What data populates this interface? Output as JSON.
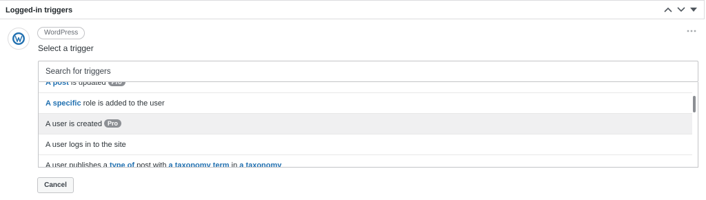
{
  "panel": {
    "title": "Logged-in triggers",
    "collapse_icon": "chevron-up-icon",
    "expand_icon": "chevron-down-icon",
    "toggle_icon": "triangle-down-icon"
  },
  "integration": {
    "avatar_icon": "wordpress-logo-icon",
    "badge": "WordPress",
    "more_icon": "more-dots-icon"
  },
  "trigger_select": {
    "label": "Select a trigger",
    "search_placeholder": "Search for triggers",
    "search_value": "",
    "hovered_index": 2,
    "scroll_position": 0.2,
    "options": [
      {
        "parts": [
          {
            "text": "A post",
            "hl": true
          },
          {
            "text": " is updated"
          }
        ],
        "pro": "Pro"
      },
      {
        "parts": [
          {
            "text": "A specific",
            "hl": true
          },
          {
            "text": " role is added to the user"
          }
        ]
      },
      {
        "parts": [
          {
            "text": "A user is created"
          }
        ],
        "pro": "Pro"
      },
      {
        "parts": [
          {
            "text": "A user logs in to the site"
          }
        ]
      },
      {
        "parts": [
          {
            "text": "A user publishes a "
          },
          {
            "text": "type of",
            "hl": true
          },
          {
            "text": " post with "
          },
          {
            "text": "a taxonomy term",
            "hl": true
          },
          {
            "text": " in "
          },
          {
            "text": "a taxonomy",
            "hl": true
          }
        ]
      }
    ]
  },
  "actions": {
    "cancel_label": "Cancel"
  },
  "colors": {
    "link": "#2271b1",
    "pro_badge": "#8c8f94",
    "hover_row": "#f0f0f1",
    "border": "#c3c4c7"
  }
}
